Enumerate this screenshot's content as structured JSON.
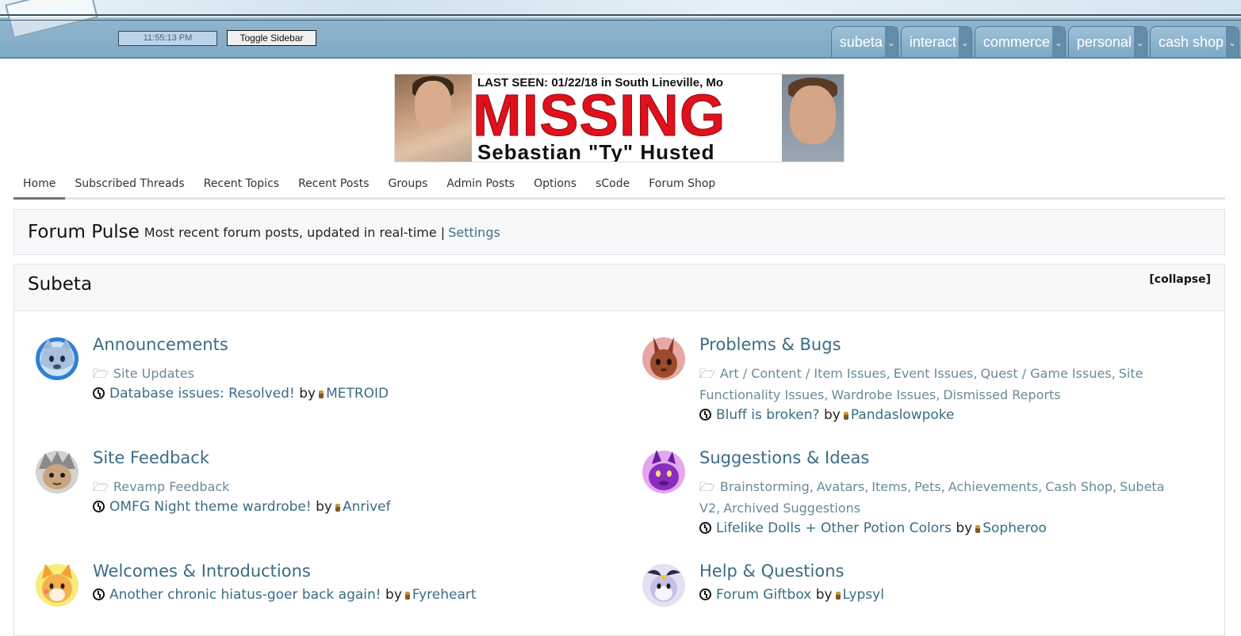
{
  "header": {
    "clock": "11:55:13 PM",
    "toggle_sidebar": "Toggle Sidebar",
    "nav": [
      {
        "label": "subeta"
      },
      {
        "label": "interact"
      },
      {
        "label": "commerce"
      },
      {
        "label": "personal"
      },
      {
        "label": "cash shop"
      }
    ]
  },
  "banner": {
    "last_seen": "LAST SEEN: 01/22/18 in South Lineville, Mo",
    "headline": "MISSING",
    "name": "Sebastian \"Ty\" Husted"
  },
  "tabs": [
    {
      "label": "Home"
    },
    {
      "label": "Subscribed Threads"
    },
    {
      "label": "Recent Topics"
    },
    {
      "label": "Recent Posts"
    },
    {
      "label": "Groups"
    },
    {
      "label": "Admin Posts"
    },
    {
      "label": "Options"
    },
    {
      "label": "sCode"
    },
    {
      "label": "Forum Shop"
    }
  ],
  "pulse": {
    "title": "Forum Pulse",
    "description": "Most recent forum posts, updated in real-time |",
    "settings": "Settings"
  },
  "section": {
    "title": "Subeta",
    "collapse": "[collapse]",
    "by": "by",
    "forums": [
      {
        "title": "Announcements",
        "subs": [
          "Site Updates"
        ],
        "last_post": "Database issues: Resolved!",
        "user": "METROID",
        "icon": "wolf-avatar-icon"
      },
      {
        "title": "Problems & Bugs",
        "subs": [
          "Art / Content / Item Issues",
          "Event Issues",
          "Quest / Game Issues",
          "Site Functionality Issues",
          "Wardrobe Issues",
          "Dismissed Reports"
        ],
        "last_post": "Bluff is broken?",
        "user": "Pandaslowpoke",
        "icon": "rabbit-avatar-icon"
      },
      {
        "title": "Site Feedback",
        "subs": [
          "Revamp Feedback"
        ],
        "last_post": "OMFG Night theme wardrobe!",
        "user": "Anrivef",
        "icon": "hedgehog-avatar-icon"
      },
      {
        "title": "Suggestions & Ideas",
        "subs": [
          "Brainstorming",
          "Avatars",
          "Items",
          "Pets",
          "Achievements",
          "Cash Shop",
          "Subeta V2",
          "Archived Suggestions"
        ],
        "last_post": "Lifelike Dolls + Other Potion Colors",
        "user": "Sopheroo",
        "icon": "dragon-avatar-icon"
      },
      {
        "title": "Welcomes & Introductions",
        "subs": [],
        "last_post": "Another chronic hiatus-goer back again!",
        "user": "Fyreheart",
        "icon": "fox-avatar-icon"
      },
      {
        "title": "Help & Questions",
        "subs": [],
        "last_post": "Forum Giftbox",
        "user": "Lypsyl",
        "icon": "creature-avatar-icon"
      }
    ]
  },
  "colors": {
    "link": "#3a6c85",
    "sub_link": "#6a8a9a",
    "header": "#7fa9c5"
  }
}
